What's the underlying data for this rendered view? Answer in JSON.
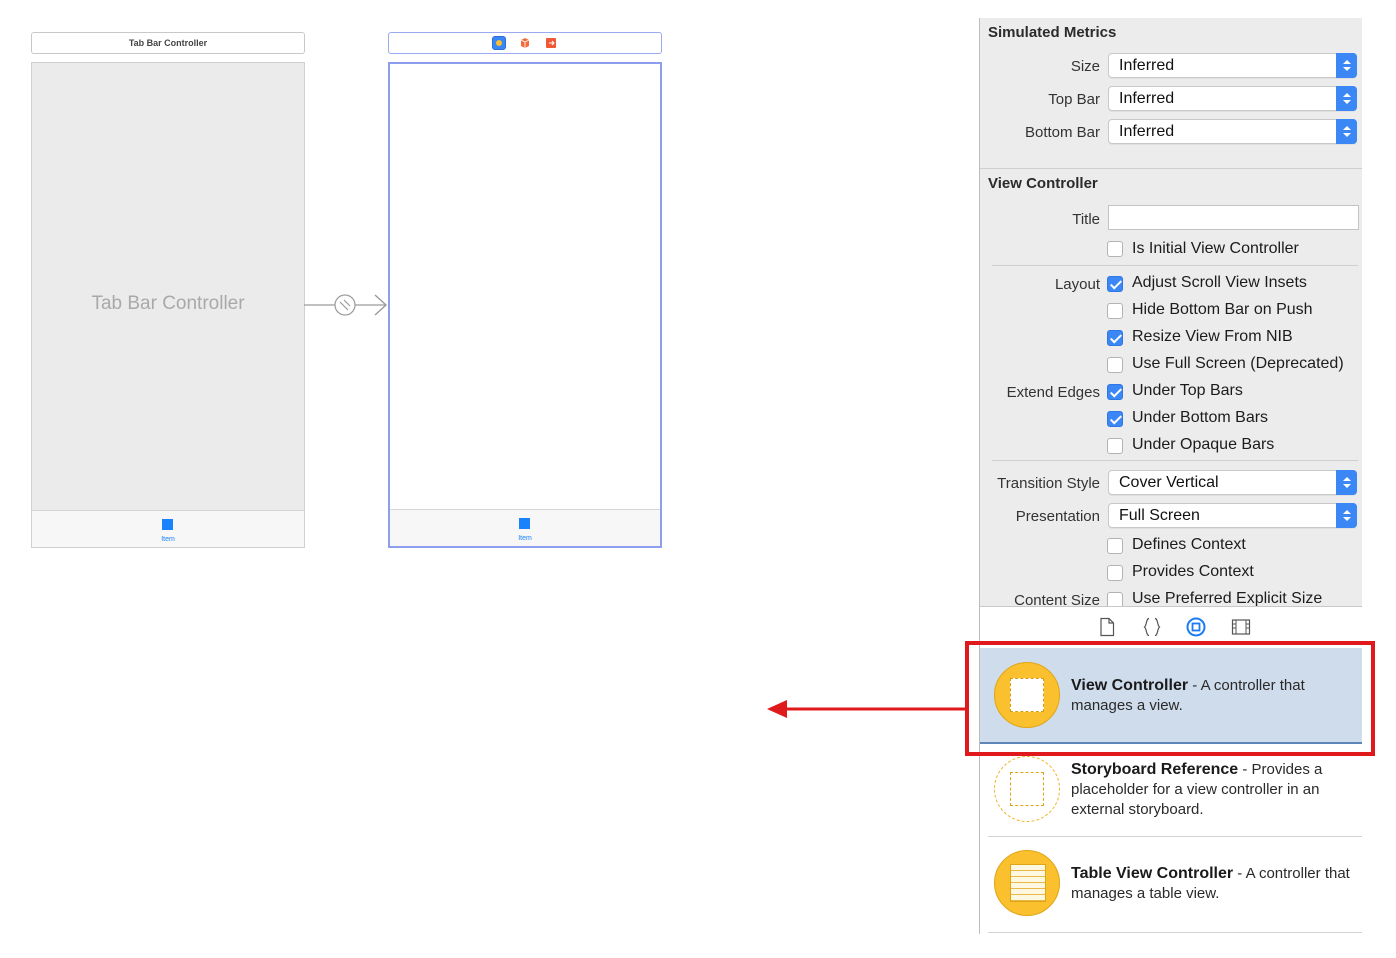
{
  "canvas": {
    "tab_bar_controller": {
      "title": "Tab Bar Controller",
      "body_label": "Tab Bar Controller",
      "tab_item_label": "Item"
    },
    "view_controller": {
      "tab_item_label": "Item",
      "dock_icons": [
        "view-controller-icon",
        "first-responder-icon",
        "exit-icon"
      ]
    },
    "segue_icon": "relationship-segue-icon"
  },
  "inspector": {
    "simulated_metrics": {
      "heading": "Simulated Metrics",
      "size_label": "Size",
      "size_value": "Inferred",
      "top_bar_label": "Top Bar",
      "top_bar_value": "Inferred",
      "bottom_bar_label": "Bottom Bar",
      "bottom_bar_value": "Inferred"
    },
    "view_controller": {
      "heading": "View Controller",
      "title_label": "Title",
      "title_value": "",
      "is_initial": {
        "label": "Is Initial View Controller",
        "checked": false
      },
      "layout_label": "Layout",
      "adjust_scroll": {
        "label": "Adjust Scroll View Insets",
        "checked": true
      },
      "hide_bottom": {
        "label": "Hide Bottom Bar on Push",
        "checked": false
      },
      "resize_nib": {
        "label": "Resize View From NIB",
        "checked": true
      },
      "full_screen": {
        "label": "Use Full Screen (Deprecated)",
        "checked": false
      },
      "extend_edges_label": "Extend Edges",
      "under_top": {
        "label": "Under Top Bars",
        "checked": true
      },
      "under_bottom": {
        "label": "Under Bottom Bars",
        "checked": true
      },
      "under_opaque": {
        "label": "Under Opaque Bars",
        "checked": false
      },
      "transition_label": "Transition Style",
      "transition_value": "Cover Vertical",
      "presentation_label": "Presentation",
      "presentation_value": "Full Screen",
      "defines_context": {
        "label": "Defines Context",
        "checked": false
      },
      "provides_context": {
        "label": "Provides Context",
        "checked": false
      },
      "content_size_label": "Content Size",
      "preferred_size": {
        "label": "Use Preferred Explicit Size",
        "checked": false
      }
    }
  },
  "library": {
    "tabs": [
      "file-template-icon",
      "code-snippet-icon",
      "object-library-icon",
      "media-library-icon"
    ],
    "items": [
      {
        "name": "View Controller",
        "desc": " - A controller that manages a view."
      },
      {
        "name": "Storyboard Reference",
        "desc": " - Provides a placeholder for a view controller in an external storyboard."
      },
      {
        "name": "Table View Controller",
        "desc": " - A controller that manages a table view."
      }
    ]
  },
  "colors": {
    "accent": "#3b87f6",
    "highlight": "#e0191d",
    "selection": "#cfdcec",
    "icon_yellow": "#fbc02d"
  }
}
